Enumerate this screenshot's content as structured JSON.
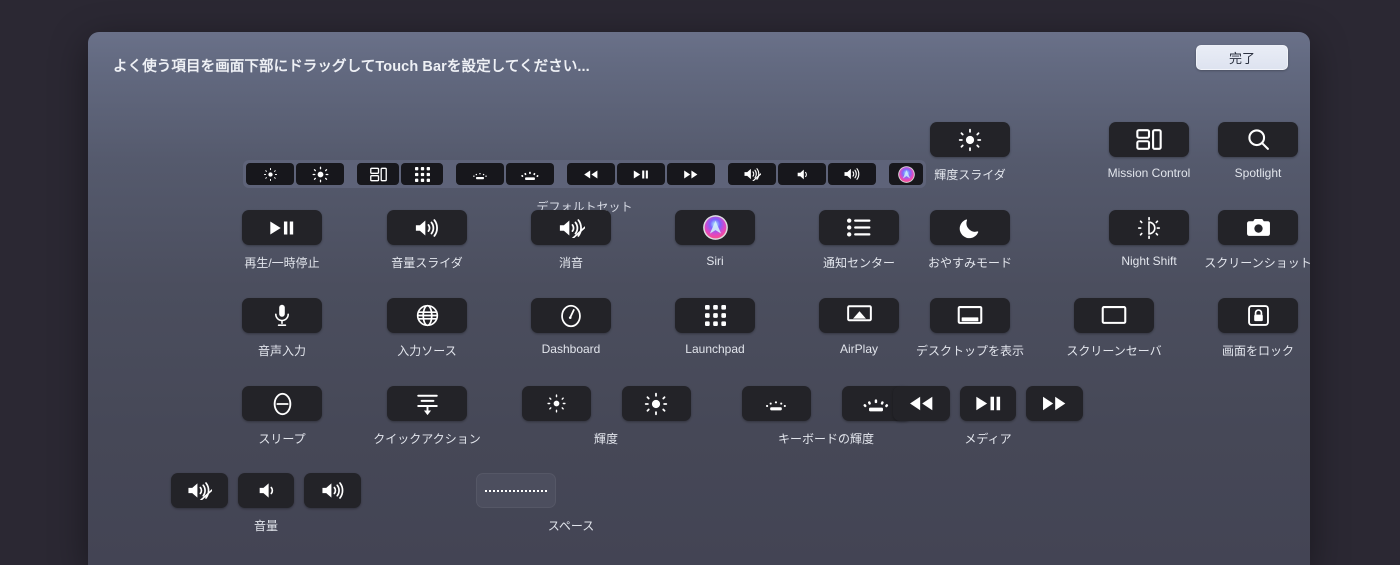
{
  "window": {
    "title": "よく使う項目を画面下部にドラッグしてTouch Barを設定してください...",
    "done_label": "完了",
    "accent_button_bg": "#e4e9f4",
    "panel_bg": "#4b4e5e",
    "key_bg": "#232328"
  },
  "default_set": {
    "label": "デフォルトセット",
    "keys": [
      {
        "icon": "brightness-down-icon",
        "name": "brightness-down"
      },
      {
        "icon": "brightness-up-icon",
        "name": "brightness-up"
      },
      {
        "icon": "mission-control-icon",
        "name": "mission-control"
      },
      {
        "icon": "launchpad-icon",
        "name": "launchpad"
      },
      {
        "icon": "keyboard-brightness-down-icon",
        "name": "keyboard-brightness-down"
      },
      {
        "icon": "keyboard-brightness-up-icon",
        "name": "keyboard-brightness-up"
      },
      {
        "icon": "rewind-icon",
        "name": "rewind"
      },
      {
        "icon": "play-pause-icon",
        "name": "play-pause"
      },
      {
        "icon": "fast-forward-icon",
        "name": "fast-forward"
      },
      {
        "icon": "volume-mute-icon",
        "name": "volume-mute"
      },
      {
        "icon": "volume-down-icon",
        "name": "volume-down"
      },
      {
        "icon": "volume-up-icon",
        "name": "volume-up"
      },
      {
        "icon": "siri-icon",
        "name": "siri"
      }
    ]
  },
  "items": {
    "play_pause": {
      "label": "再生/一時停止",
      "icon": "play-pause-icon"
    },
    "volume_slider": {
      "label": "音量スライダ",
      "icon": "volume-up-icon"
    },
    "mute": {
      "label": "消音",
      "icon": "volume-mute-icon"
    },
    "siri": {
      "label": "Siri",
      "icon": "siri-icon"
    },
    "notification": {
      "label": "通知センター",
      "icon": "notification-center-icon"
    },
    "brightness_slider": {
      "label": "輝度スライダ",
      "icon": "brightness-up-icon"
    },
    "mission_control": {
      "label": "Mission Control",
      "icon": "mission-control-icon"
    },
    "spotlight": {
      "label": "Spotlight",
      "icon": "search-icon"
    },
    "dictation": {
      "label": "音声入力",
      "icon": "microphone-icon"
    },
    "input_source": {
      "label": "入力ソース",
      "icon": "globe-icon"
    },
    "dashboard": {
      "label": "Dashboard",
      "icon": "dashboard-icon"
    },
    "launchpad": {
      "label": "Launchpad",
      "icon": "launchpad-icon"
    },
    "airplay": {
      "label": "AirPlay",
      "icon": "airplay-icon"
    },
    "do_not_disturb": {
      "label": "おやすみモード",
      "icon": "moon-icon"
    },
    "night_shift": {
      "label": "Night Shift",
      "icon": "night-shift-icon"
    },
    "screenshot": {
      "label": "スクリーンショット",
      "icon": "camera-icon"
    },
    "sleep": {
      "label": "スリープ",
      "icon": "sleep-icon"
    },
    "quick_action": {
      "label": "クイックアクション",
      "icon": "quick-action-icon"
    },
    "show_desktop": {
      "label": "デスクトップを表示",
      "icon": "show-desktop-icon"
    },
    "screensaver": {
      "label": "スクリーンセーバ",
      "icon": "screensaver-icon"
    },
    "lock_screen": {
      "label": "画面をロック",
      "icon": "lock-icon"
    },
    "space": {
      "label": "スペース",
      "icon": "space-dots-icon"
    }
  },
  "groups": {
    "brightness": {
      "label": "輝度",
      "keys": [
        {
          "icon": "brightness-down-icon",
          "name": "brightness-down"
        },
        {
          "icon": "brightness-up-icon",
          "name": "brightness-up"
        }
      ]
    },
    "keyboard_brightness": {
      "label": "キーボードの輝度",
      "keys": [
        {
          "icon": "keyboard-brightness-down-icon",
          "name": "keyboard-brightness-down"
        },
        {
          "icon": "keyboard-brightness-up-icon",
          "name": "keyboard-brightness-up"
        }
      ]
    },
    "media": {
      "label": "メディア",
      "keys": [
        {
          "icon": "rewind-icon",
          "name": "rewind"
        },
        {
          "icon": "play-pause-icon",
          "name": "play-pause"
        },
        {
          "icon": "fast-forward-icon",
          "name": "fast-forward"
        }
      ]
    },
    "volume": {
      "label": "音量",
      "keys": [
        {
          "icon": "volume-mute-icon",
          "name": "volume-mute"
        },
        {
          "icon": "volume-down-icon",
          "name": "volume-down"
        },
        {
          "icon": "volume-up-icon",
          "name": "volume-up"
        }
      ]
    }
  }
}
